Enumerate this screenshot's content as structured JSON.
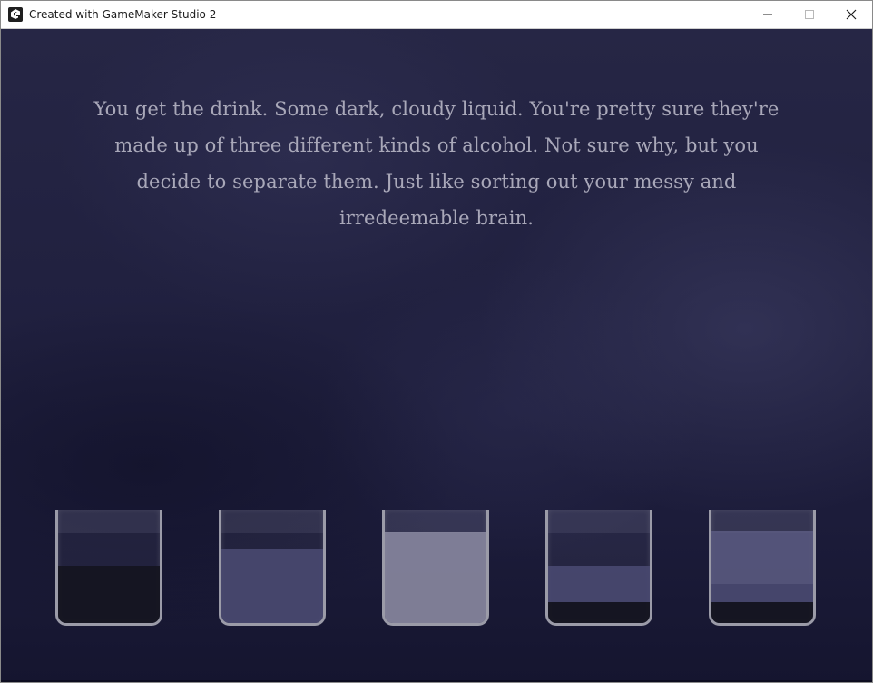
{
  "window": {
    "title": "Created with GameMaker Studio 2",
    "icon": "gamemaker-icon",
    "controls": [
      "minimize-icon",
      "maximize-icon",
      "close-icon"
    ]
  },
  "game": {
    "narration": "You get the drink. Some dark, cloudy liquid. You're pretty sure they're made up of three different kinds of alcohol. Not sure why, but you decide to separate them. Just like sorting out your messy and irredeemable brain.",
    "colors": {
      "background": "#20203f",
      "text": "#a9a8b9",
      "glass_outline": "#9b9ba8",
      "liquid_dark": "#15151f",
      "liquid_indigo": "#4b4b73",
      "liquid_light": "#8e8da4"
    },
    "glasses": [
      {
        "id": 1,
        "layers": [
          {
            "color": "liquid_dark",
            "fraction": 0.5
          }
        ]
      },
      {
        "id": 2,
        "layers": [
          {
            "color": "liquid_indigo",
            "fraction": 0.65
          }
        ]
      },
      {
        "id": 3,
        "layers": [
          {
            "color": "liquid_light",
            "fraction": 0.8
          }
        ]
      },
      {
        "id": 4,
        "layers": [
          {
            "color": "liquid_dark",
            "fraction": 0.18
          },
          {
            "color": "liquid_indigo",
            "fraction": 0.32
          }
        ]
      },
      {
        "id": 5,
        "layers": [
          {
            "color": "liquid_dark",
            "fraction": 0.18
          },
          {
            "color": "liquid_indigo",
            "fraction": 0.16
          },
          {
            "color": "liquid_indigo",
            "fraction": 0.46
          }
        ]
      }
    ]
  }
}
